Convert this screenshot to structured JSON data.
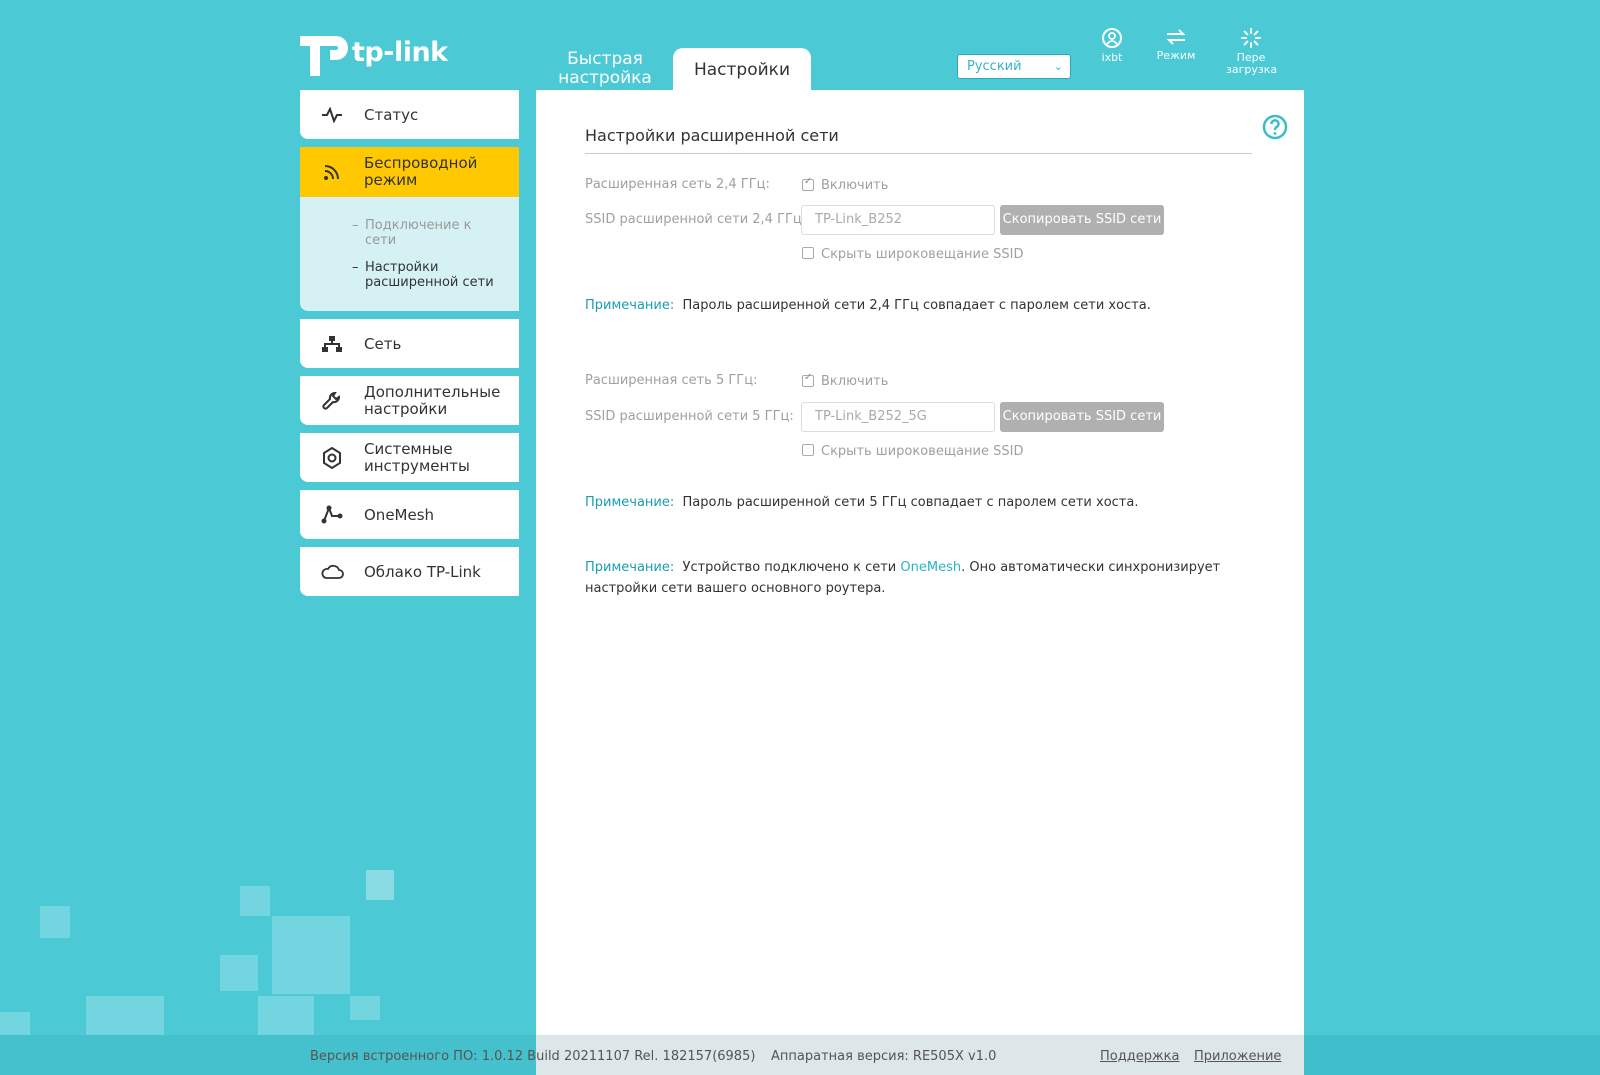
{
  "brand": {
    "logo_text": "tp-link"
  },
  "header": {
    "tabs": [
      {
        "label": "Быстрая настройка"
      },
      {
        "label": "Настройки"
      }
    ],
    "language": "Русский",
    "icons": [
      {
        "label": "ixbt",
        "icon": "user-icon"
      },
      {
        "label": "Режим",
        "icon": "mode-switch-icon"
      },
      {
        "label": "Пере загрузка",
        "icon": "reboot-icon"
      }
    ]
  },
  "sidebar": {
    "items": [
      {
        "label": "Статус",
        "icon": "pulse-icon"
      },
      {
        "label": "Беспроводной режим",
        "icon": "wireless-icon"
      },
      {
        "label": "Сеть",
        "icon": "network-icon"
      },
      {
        "label": "Дополнительные настройки",
        "icon": "wrench-icon"
      },
      {
        "label": "Системные инструменты",
        "icon": "gear-icon"
      },
      {
        "label": "OneMesh",
        "icon": "mesh-icon"
      },
      {
        "label": "Облако TP-Link",
        "icon": "cloud-icon"
      }
    ],
    "subitems": [
      {
        "label": "Подключение к сети"
      },
      {
        "label": "Настройки расширенной сети"
      }
    ],
    "active_color": "#ffc800"
  },
  "main": {
    "title": "Настройки расширенной сети",
    "band24": {
      "enable_label": "Расширенная сеть 2,4 ГГц:",
      "enable_checkbox": "Включить",
      "ssid_label": "SSID расширенной сети 2,4 ГГц:",
      "ssid_value": "TP-Link_B252",
      "copy_button": "Скопировать SSID сети",
      "hide_checkbox": "Скрыть широковещание SSID",
      "note_label": "Примечание:",
      "note_text": "Пароль расширенной сети 2,4 ГГц совпадает с паролем сети хоста."
    },
    "band5": {
      "enable_label": "Расширенная сеть 5 ГГц:",
      "enable_checkbox": "Включить",
      "ssid_label": "SSID расширенной сети 5 ГГц:",
      "ssid_value": "TP-Link_B252_5G",
      "copy_button": "Скопировать SSID сети",
      "hide_checkbox": "Скрыть широковещание SSID",
      "note_label": "Примечание:",
      "note_text": "Пароль расширенной сети 5 ГГц совпадает с паролем сети хоста."
    },
    "mesh_note": {
      "label": "Примечание:",
      "before": "Устройство подключено к сети",
      "link": "OneMesh",
      "after": ". Оно автоматически синхронизирует настройки сети вашего основного роутера."
    }
  },
  "footer": {
    "firmware": "Версия встроенного ПО: 1.0.12 Build 20211107 Rel. 182157(6985)",
    "hardware": "Аппаратная версия: RE505X v1.0",
    "support": "Поддержка",
    "app": "Приложение"
  }
}
